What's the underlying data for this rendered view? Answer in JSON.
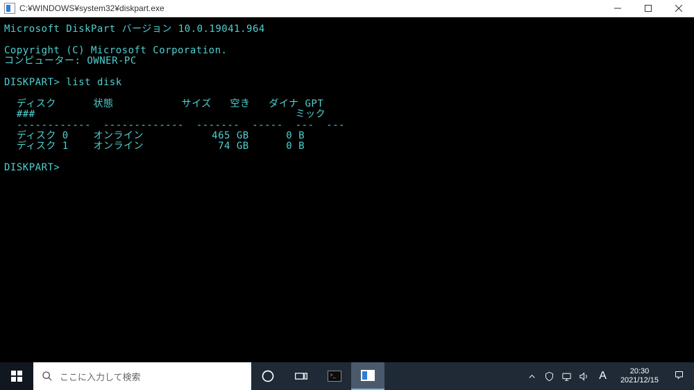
{
  "window": {
    "title": "C:¥WINDOWS¥system32¥diskpart.exe"
  },
  "terminal": {
    "version_line": "Microsoft DiskPart バージョン 10.0.19041.964",
    "copyright": "Copyright (C) Microsoft Corporation.",
    "computer_line": "コンピューター: OWNER-PC",
    "prompt": "DISKPART>",
    "command": "list disk",
    "header1": "  ディスク      状態           サイズ   空き   ダイナ GPT",
    "header2": "  ###                                          ミック",
    "divider": "  ------------  -------------  -------  -----  ---  ---",
    "rows": [
      "  ディスク 0    オンライン           465 GB      0 B",
      "  ディスク 1    オンライン            74 GB      0 B"
    ]
  },
  "taskbar": {
    "search_placeholder": "ここに入力して検索",
    "ime": "A",
    "time": "20:30",
    "date": "2021/12/15"
  }
}
